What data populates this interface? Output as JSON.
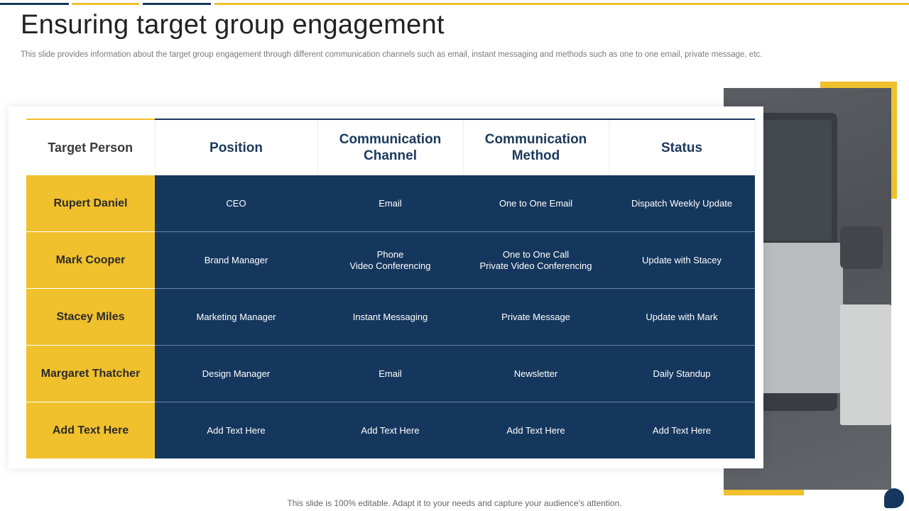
{
  "slide": {
    "title": "Ensuring target group engagement",
    "subtitle": "This slide provides information about the target group engagement through different communication channels such as email, instant messaging and methods such as one to one email, private message, etc.",
    "footer": "This slide is 100% editable. Adapt it to your needs and capture your audience's attention."
  },
  "colors": {
    "navy": "#15375d",
    "yellow": "#f0c02d",
    "title": "#222222"
  },
  "icons": {
    "chat": "chat-bubble-icon"
  },
  "table": {
    "headers": [
      [
        "Target Person"
      ],
      [
        "Position"
      ],
      [
        "Communication",
        "Channel"
      ],
      [
        "Communication",
        "Method"
      ],
      [
        "Status"
      ]
    ],
    "rows": [
      {
        "name": "Rupert Daniel",
        "position": [
          "CEO"
        ],
        "channel": [
          "Email"
        ],
        "method": [
          "One to One Email"
        ],
        "status": [
          "Dispatch Weekly Update"
        ]
      },
      {
        "name": "Mark Cooper",
        "position": [
          "Brand Manager"
        ],
        "channel": [
          "Phone",
          "Video Conferencing"
        ],
        "method": [
          "One to One Call",
          "Private  Video Conferencing"
        ],
        "status": [
          "Update with Stacey"
        ]
      },
      {
        "name": "Stacey Miles",
        "position": [
          "Marketing Manager"
        ],
        "channel": [
          "Instant Messaging"
        ],
        "method": [
          "Private Message"
        ],
        "status": [
          "Update with Mark"
        ]
      },
      {
        "name": "Margaret Thatcher",
        "position": [
          "Design Manager"
        ],
        "channel": [
          "Email"
        ],
        "method": [
          "Newsletter"
        ],
        "status": [
          "Daily Standup"
        ]
      },
      {
        "name": "Add Text Here",
        "position": [
          "Add Text Here"
        ],
        "channel": [
          "Add Text Here"
        ],
        "method": [
          "Add Text Here"
        ],
        "status": [
          "Add Text Here"
        ]
      }
    ]
  }
}
